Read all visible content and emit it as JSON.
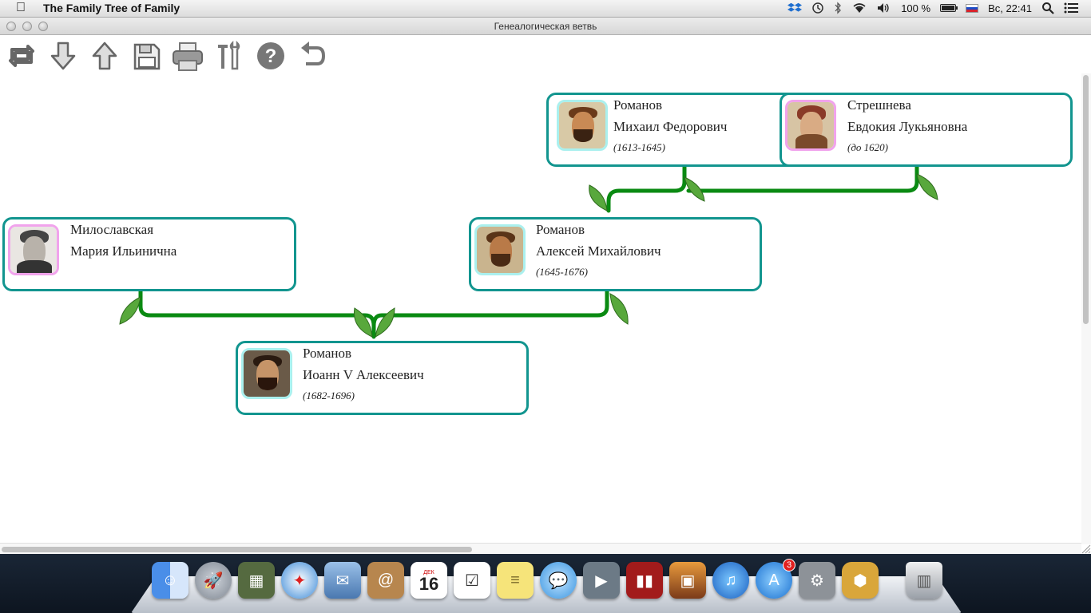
{
  "menubar": {
    "app_name": "The Family Tree of Family",
    "battery": "100 %",
    "clock": "Вс, 22:41"
  },
  "window": {
    "title": "Генеалогическая ветвь"
  },
  "toolbar": {
    "items": [
      "refresh-icon",
      "arrow-down-icon",
      "arrow-up-icon",
      "save-icon",
      "print-icon",
      "tools-icon",
      "help-icon",
      "undo-icon"
    ]
  },
  "tree": {
    "persons": [
      {
        "id": "mikhail",
        "surname": "Романов",
        "given": "Михаил Федорович",
        "dates": "(1613-1645)",
        "sex": "m"
      },
      {
        "id": "evdokia",
        "surname": "Стрешнева",
        "given": "Евдокия Лукьяновна",
        "dates": "(до 1620)",
        "sex": "f"
      },
      {
        "id": "maria",
        "surname": "Милославская",
        "given": "Мария Ильинична",
        "dates": "",
        "sex": "f"
      },
      {
        "id": "alexei",
        "surname": "Романов",
        "given": "Алексей Михайлович",
        "dates": "(1645-1676)",
        "sex": "m"
      },
      {
        "id": "ioann",
        "surname": "Романов",
        "given": "Иоанн V Алексеевич",
        "dates": "(1682-1696)",
        "sex": "m"
      }
    ],
    "colors": {
      "card_border": "#12958f",
      "branch": "#0a8a12",
      "leaf": "#58a83c",
      "male_frame": "#aaf0ee",
      "female_frame": "#f1a3ec"
    }
  },
  "dock": {
    "apps": [
      "finder-icon",
      "launchpad-icon",
      "photo-browser-icon",
      "safari-icon",
      "mail-icon",
      "contacts-icon",
      "calendar-icon",
      "reminders-icon",
      "notes-icon",
      "messages-icon",
      "facetime-icon",
      "photo-booth-icon",
      "iphoto-icon",
      "itunes-icon",
      "app-store-icon",
      "system-preferences-icon",
      "family-tree-icon",
      "trash-icon"
    ],
    "calendar_month": "ДЕК",
    "calendar_day": "16",
    "app_store_badge": "3"
  }
}
